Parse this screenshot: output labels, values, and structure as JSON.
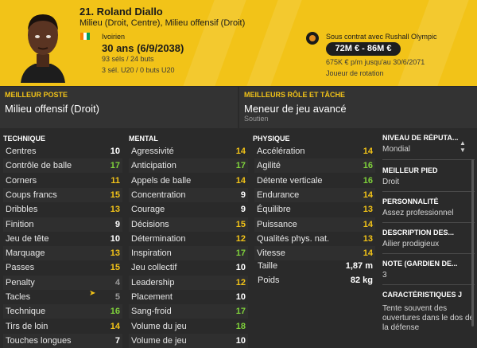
{
  "player": {
    "name": "21. Roland Diallo",
    "positions": "Milieu (Droit, Centre), Milieu offensif (Droit)",
    "nationality": "Ivoirien",
    "age": "30 ans (6/9/2038)",
    "caps": "93 séls / 24 buts",
    "u20": "3 sél. U20 / 0 buts U20",
    "flag_colors": [
      "#f77f00",
      "#ffffff",
      "#009e60"
    ]
  },
  "contract": {
    "club_text": "Sous contrat avec Rushall Olympic",
    "value_range": "72M € - 86M €",
    "wage": "675K € p/m jusqu'au 30/6/2071",
    "status": "Joueur de rotation"
  },
  "best_position": {
    "label": "MEILLEUR POSTE",
    "value": "Milieu offensif (Droit)"
  },
  "best_role": {
    "label": "MEILLEURS RÔLE ET TÂCHE",
    "value": "Meneur de jeu avancé",
    "duty": "Soutien"
  },
  "technique": {
    "title": "TECHNIQUE",
    "rows": [
      {
        "label": "Centres",
        "value": "10"
      },
      {
        "label": "Contrôle de balle",
        "value": "17"
      },
      {
        "label": "Corners",
        "value": "11"
      },
      {
        "label": "Coups francs",
        "value": "15"
      },
      {
        "label": "Dribbles",
        "value": "13"
      },
      {
        "label": "Finition",
        "value": "9"
      },
      {
        "label": "Jeu de tête",
        "value": "10"
      },
      {
        "label": "Marquage",
        "value": "13"
      },
      {
        "label": "Passes",
        "value": "15"
      },
      {
        "label": "Penalty",
        "value": "4"
      },
      {
        "label": "Tacles",
        "value": "5"
      },
      {
        "label": "Technique",
        "value": "16"
      },
      {
        "label": "Tirs de loin",
        "value": "14"
      },
      {
        "label": "Touches longues",
        "value": "7"
      }
    ]
  },
  "mental": {
    "title": "MENTAL",
    "rows": [
      {
        "label": "Agressivité",
        "value": "14"
      },
      {
        "label": "Anticipation",
        "value": "17"
      },
      {
        "label": "Appels de balle",
        "value": "14"
      },
      {
        "label": "Concentration",
        "value": "9"
      },
      {
        "label": "Courage",
        "value": "9"
      },
      {
        "label": "Décisions",
        "value": "15"
      },
      {
        "label": "Détermination",
        "value": "12"
      },
      {
        "label": "Inspiration",
        "value": "17"
      },
      {
        "label": "Jeu collectif",
        "value": "10"
      },
      {
        "label": "Leadership",
        "value": "12"
      },
      {
        "label": "Placement",
        "value": "10"
      },
      {
        "label": "Sang-froid",
        "value": "17"
      },
      {
        "label": "Volume du jeu",
        "value": "18"
      },
      {
        "label": "Volume de jeu",
        "value": "10"
      }
    ]
  },
  "physique": {
    "title": "PHYSIQUE",
    "rows": [
      {
        "label": "Accélération",
        "value": "14"
      },
      {
        "label": "Agilité",
        "value": "16"
      },
      {
        "label": "Détente verticale",
        "value": "16"
      },
      {
        "label": "Endurance",
        "value": "14"
      },
      {
        "label": "Équilibre",
        "value": "13"
      },
      {
        "label": "Puissance",
        "value": "14"
      },
      {
        "label": "Qualités phys. nat.",
        "value": "13"
      },
      {
        "label": "Vitesse",
        "value": "14"
      }
    ],
    "height_label": "Taille",
    "height_value": "1,87 m",
    "weight_label": "Poids",
    "weight_value": "82 kg"
  },
  "side": {
    "reputation_label": "NIVEAU DE RÉPUTA...",
    "reputation_value": "Mondial",
    "foot_label": "MEILLEUR PIED",
    "foot_value": "Droit",
    "personality_label": "PERSONNALITÉ",
    "personality_value": "Assez professionnel",
    "description_label": "DESCRIPTION DES...",
    "description_value": "Ailier prodigieux",
    "gk_label": "NOTE (GARDIEN DE...",
    "gk_value": "3",
    "traits_label": "CARACTÉRISTIQUES J",
    "traits_value": "Tente souvent des ouvertures dans le dos de la défense"
  },
  "colors": {
    "accent": "#f2c318",
    "low": "#9a9a9a",
    "mid": "#ffffff",
    "high": "#f2c318",
    "great": "#7fd13b"
  }
}
